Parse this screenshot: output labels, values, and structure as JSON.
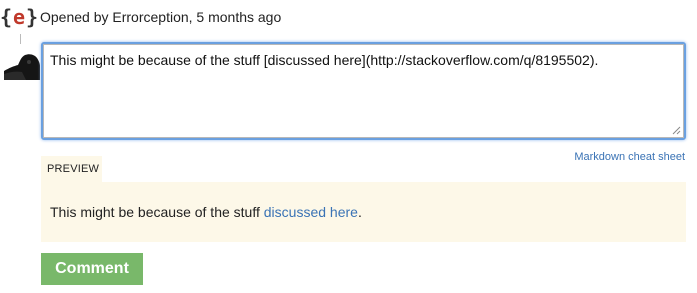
{
  "header": {
    "logo_left": "{",
    "logo_mid": "e",
    "logo_right": "}",
    "opened_text": "Opened by Errorception, 5 months ago"
  },
  "editor": {
    "value": "This might be because of the stuff [discussed here](http://stackoverflow.com/q/8195502)."
  },
  "links": {
    "markdown_cheat_sheet": "Markdown cheat sheet"
  },
  "preview": {
    "tab_label": "PREVIEW",
    "text_before": "This might be because of the stuff ",
    "link_text": "discussed here",
    "text_after": "."
  },
  "actions": {
    "comment_label": "Comment"
  },
  "colors": {
    "brand_red": "#c0392b",
    "link_blue": "#3a73b5",
    "preview_bg": "#fdf8e8",
    "button_green": "#79b86a",
    "focus_blue": "#6aa0e0"
  },
  "icons": {
    "logo": "errorception-logo-icon",
    "avatar": "user-avatar",
    "resize": "resize-grip-icon"
  }
}
